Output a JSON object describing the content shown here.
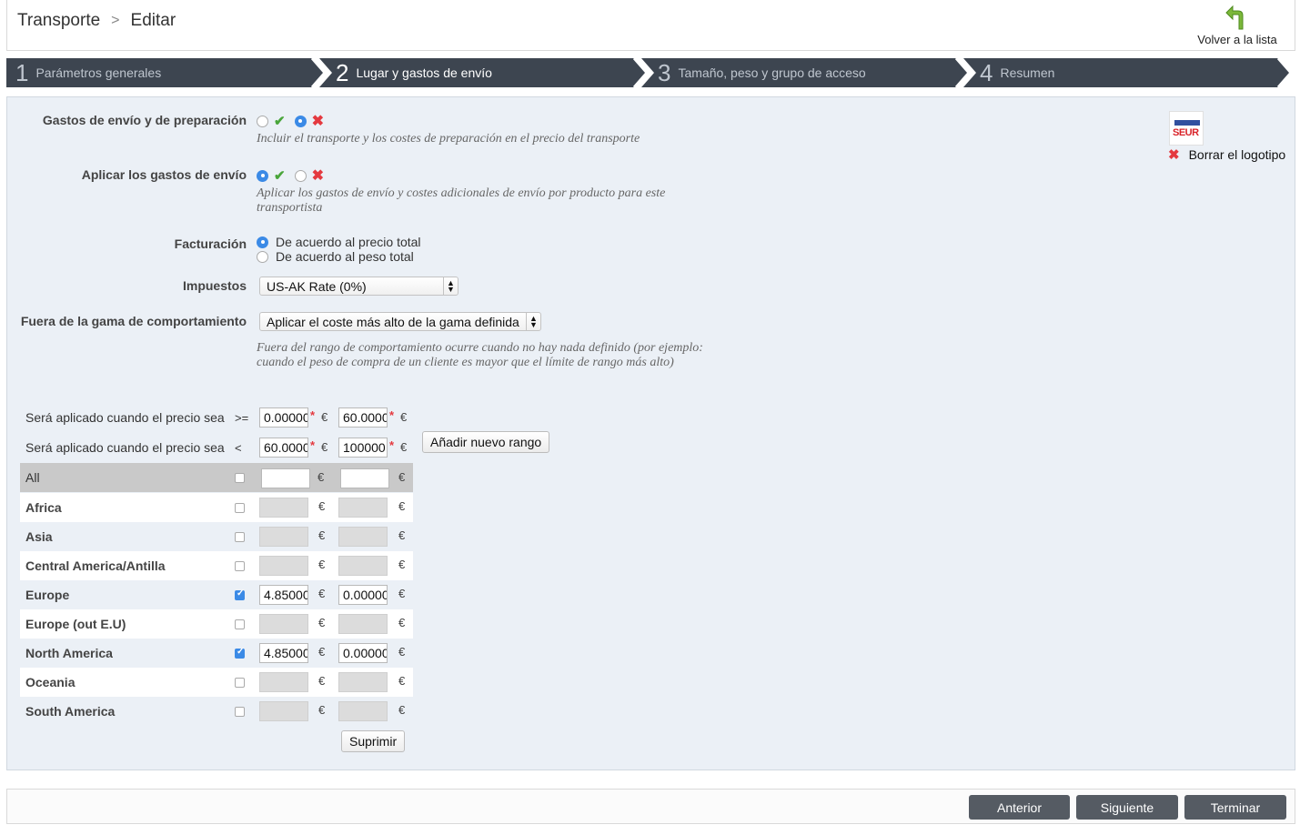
{
  "breadcrumb": {
    "section": "Transporte",
    "separator": ">",
    "page": "Editar"
  },
  "back": {
    "label": "Volver a la lista"
  },
  "steps": [
    {
      "num": "1",
      "label": "Parámetros generales"
    },
    {
      "num": "2",
      "label": "Lugar y gastos de envío"
    },
    {
      "num": "3",
      "label": "Tamaño, peso y grupo de acceso"
    },
    {
      "num": "4",
      "label": "Resumen"
    }
  ],
  "form": {
    "shipping_handling": {
      "label": "Gastos de envío y de preparación",
      "value": "no",
      "hint": "Incluir el transporte y los costes de preparación en el precio del transporte"
    },
    "apply_shipping": {
      "label": "Aplicar los gastos de envío",
      "value": "yes",
      "hint": "Aplicar los gastos de envío y costes adicionales de envío por producto para este transportista"
    },
    "billing": {
      "label": "Facturación",
      "options": [
        "De acuerdo al precio total",
        "De acuerdo al peso total"
      ],
      "selected": 0
    },
    "tax": {
      "label": "Impuestos",
      "value": "US-AK Rate (0%)"
    },
    "out_of_range": {
      "label": "Fuera de la gama de comportamiento",
      "value": "Aplicar el coste más alto de la gama definida",
      "hint": "Fuera del rango de comportamiento ocurre cuando no hay nada definido (por ejemplo: cuando el peso de compra de un cliente es mayor que el límite de rango más alto)"
    }
  },
  "logo": {
    "text": "SEUR",
    "delete_label": "Borrar el logotipo"
  },
  "ranges": {
    "row_label": "Será aplicado cuando el precio sea",
    "currency": "€",
    "required": "*",
    "lower": {
      "op": ">=",
      "from": "0.000000",
      "to": "60.000000"
    },
    "upper": {
      "op": "<",
      "from": "60.000000",
      "to": "100000"
    },
    "add_button": "Añadir nuevo rango",
    "delete_button": "Suprimir"
  },
  "zones": [
    {
      "name": "All",
      "checked": false,
      "v1": "",
      "v2": ""
    },
    {
      "name": "Africa",
      "checked": false,
      "v1": "",
      "v2": ""
    },
    {
      "name": "Asia",
      "checked": false,
      "v1": "",
      "v2": ""
    },
    {
      "name": "Central America/Antilla",
      "checked": false,
      "v1": "",
      "v2": ""
    },
    {
      "name": "Europe",
      "checked": true,
      "v1": "4.850000",
      "v2": "0.000000"
    },
    {
      "name": "Europe (out E.U)",
      "checked": false,
      "v1": "",
      "v2": ""
    },
    {
      "name": "North America",
      "checked": true,
      "v1": "4.850000",
      "v2": "0.000000"
    },
    {
      "name": "Oceania",
      "checked": false,
      "v1": "",
      "v2": ""
    },
    {
      "name": "South America",
      "checked": false,
      "v1": "",
      "v2": ""
    }
  ],
  "footer": {
    "prev": "Anterior",
    "next": "Siguiente",
    "finish": "Terminar"
  },
  "colors": {
    "step_bg": "#3d4550",
    "panel_bg": "#ebf0f6",
    "button_bg": "#555b63",
    "accent": "#3b8ae6"
  }
}
